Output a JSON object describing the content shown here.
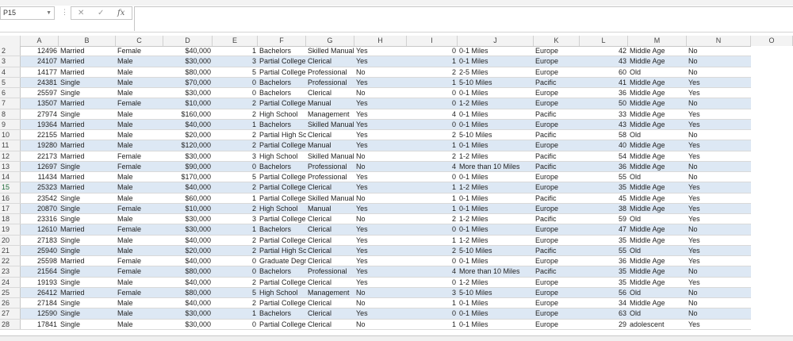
{
  "name_box": "P15",
  "formula_icons": {
    "more": "⋮",
    "cancel": "✕",
    "enter": "✓",
    "fx": "fx"
  },
  "formula_value": "",
  "columns": [
    "A",
    "B",
    "C",
    "D",
    "E",
    "F",
    "G",
    "H",
    "I",
    "J",
    "K",
    "L",
    "M",
    "N",
    "O"
  ],
  "selected_row": "15",
  "rows": [
    [
      "2",
      "12496",
      "Married",
      "Female",
      "$40,000",
      "1",
      "Bachelors",
      "Skilled Manual",
      "Yes",
      "0",
      "0-1 Miles",
      "Europe",
      "42",
      "Middle Age",
      "No"
    ],
    [
      "3",
      "24107",
      "Married",
      "Male",
      "$30,000",
      "3",
      "Partial College",
      "Clerical",
      "Yes",
      "1",
      "0-1 Miles",
      "Europe",
      "43",
      "Middle Age",
      "No"
    ],
    [
      "4",
      "14177",
      "Married",
      "Male",
      "$80,000",
      "5",
      "Partial College",
      "Professional",
      "No",
      "2",
      "2-5 Miles",
      "Europe",
      "60",
      "Old",
      "No"
    ],
    [
      "5",
      "24381",
      "Single",
      "Male",
      "$70,000",
      "0",
      "Bachelors",
      "Professional",
      "Yes",
      "1",
      "5-10 Miles",
      "Pacific",
      "41",
      "Middle Age",
      "Yes"
    ],
    [
      "6",
      "25597",
      "Single",
      "Male",
      "$30,000",
      "0",
      "Bachelors",
      "Clerical",
      "No",
      "0",
      "0-1 Miles",
      "Europe",
      "36",
      "Middle Age",
      "Yes"
    ],
    [
      "7",
      "13507",
      "Married",
      "Female",
      "$10,000",
      "2",
      "Partial College",
      "Manual",
      "Yes",
      "0",
      "1-2 Miles",
      "Europe",
      "50",
      "Middle Age",
      "No"
    ],
    [
      "8",
      "27974",
      "Single",
      "Male",
      "$160,000",
      "2",
      "High School",
      "Management",
      "Yes",
      "4",
      "0-1 Miles",
      "Pacific",
      "33",
      "Middle Age",
      "Yes"
    ],
    [
      "9",
      "19364",
      "Married",
      "Male",
      "$40,000",
      "1",
      "Bachelors",
      "Skilled Manual",
      "Yes",
      "0",
      "0-1 Miles",
      "Europe",
      "43",
      "Middle Age",
      "Yes"
    ],
    [
      "10",
      "22155",
      "Married",
      "Male",
      "$20,000",
      "2",
      "Partial High School",
      "Clerical",
      "Yes",
      "2",
      "5-10 Miles",
      "Pacific",
      "58",
      "Old",
      "No"
    ],
    [
      "11",
      "19280",
      "Married",
      "Male",
      "$120,000",
      "2",
      "Partial College",
      "Manual",
      "Yes",
      "1",
      "0-1 Miles",
      "Europe",
      "40",
      "Middle Age",
      "Yes"
    ],
    [
      "12",
      "22173",
      "Married",
      "Female",
      "$30,000",
      "3",
      "High School",
      "Skilled Manual",
      "No",
      "2",
      "1-2 Miles",
      "Pacific",
      "54",
      "Middle Age",
      "Yes"
    ],
    [
      "13",
      "12697",
      "Single",
      "Female",
      "$90,000",
      "0",
      "Bachelors",
      "Professional",
      "No",
      "4",
      "More than 10 Miles",
      "Pacific",
      "36",
      "Middle Age",
      "No"
    ],
    [
      "14",
      "11434",
      "Married",
      "Male",
      "$170,000",
      "5",
      "Partial College",
      "Professional",
      "Yes",
      "0",
      "0-1 Miles",
      "Europe",
      "55",
      "Old",
      "No"
    ],
    [
      "15",
      "25323",
      "Married",
      "Male",
      "$40,000",
      "2",
      "Partial College",
      "Clerical",
      "Yes",
      "1",
      "1-2 Miles",
      "Europe",
      "35",
      "Middle Age",
      "Yes"
    ],
    [
      "16",
      "23542",
      "Single",
      "Male",
      "$60,000",
      "1",
      "Partial College",
      "Skilled Manual",
      "No",
      "1",
      "0-1 Miles",
      "Pacific",
      "45",
      "Middle Age",
      "Yes"
    ],
    [
      "17",
      "20870",
      "Single",
      "Female",
      "$10,000",
      "2",
      "High School",
      "Manual",
      "Yes",
      "1",
      "0-1 Miles",
      "Europe",
      "38",
      "Middle Age",
      "Yes"
    ],
    [
      "18",
      "23316",
      "Single",
      "Male",
      "$30,000",
      "3",
      "Partial College",
      "Clerical",
      "No",
      "2",
      "1-2 Miles",
      "Pacific",
      "59",
      "Old",
      "Yes"
    ],
    [
      "19",
      "12610",
      "Married",
      "Female",
      "$30,000",
      "1",
      "Bachelors",
      "Clerical",
      "Yes",
      "0",
      "0-1 Miles",
      "Europe",
      "47",
      "Middle Age",
      "No"
    ],
    [
      "20",
      "27183",
      "Single",
      "Male",
      "$40,000",
      "2",
      "Partial College",
      "Clerical",
      "Yes",
      "1",
      "1-2 Miles",
      "Europe",
      "35",
      "Middle Age",
      "Yes"
    ],
    [
      "21",
      "25940",
      "Single",
      "Male",
      "$20,000",
      "2",
      "Partial High School",
      "Clerical",
      "Yes",
      "2",
      "5-10 Miles",
      "Pacific",
      "55",
      "Old",
      "Yes"
    ],
    [
      "22",
      "25598",
      "Married",
      "Female",
      "$40,000",
      "0",
      "Graduate Degree",
      "Clerical",
      "Yes",
      "0",
      "0-1 Miles",
      "Europe",
      "36",
      "Middle Age",
      "Yes"
    ],
    [
      "23",
      "21564",
      "Single",
      "Female",
      "$80,000",
      "0",
      "Bachelors",
      "Professional",
      "Yes",
      "4",
      "More than 10 Miles",
      "Pacific",
      "35",
      "Middle Age",
      "No"
    ],
    [
      "24",
      "19193",
      "Single",
      "Male",
      "$40,000",
      "2",
      "Partial College",
      "Clerical",
      "Yes",
      "0",
      "1-2 Miles",
      "Europe",
      "35",
      "Middle Age",
      "Yes"
    ],
    [
      "25",
      "26412",
      "Married",
      "Female",
      "$80,000",
      "5",
      "High School",
      "Management",
      "No",
      "3",
      "5-10 Miles",
      "Europe",
      "56",
      "Old",
      "No"
    ],
    [
      "26",
      "27184",
      "Single",
      "Male",
      "$40,000",
      "2",
      "Partial College",
      "Clerical",
      "No",
      "1",
      "0-1 Miles",
      "Europe",
      "34",
      "Middle Age",
      "No"
    ],
    [
      "27",
      "12590",
      "Single",
      "Male",
      "$30,000",
      "1",
      "Bachelors",
      "Clerical",
      "Yes",
      "0",
      "0-1 Miles",
      "Europe",
      "63",
      "Old",
      "No"
    ],
    [
      "28",
      "17841",
      "Single",
      "Male",
      "$30,000",
      "0",
      "Partial College",
      "Clerical",
      "No",
      "1",
      "0-1 Miles",
      "Europe",
      "29",
      "adolescent",
      "Yes"
    ]
  ],
  "colors": {
    "band": "#dde8f4",
    "header_bg": "#f3f3f3",
    "selected_row_text": "#1f6b3a"
  }
}
